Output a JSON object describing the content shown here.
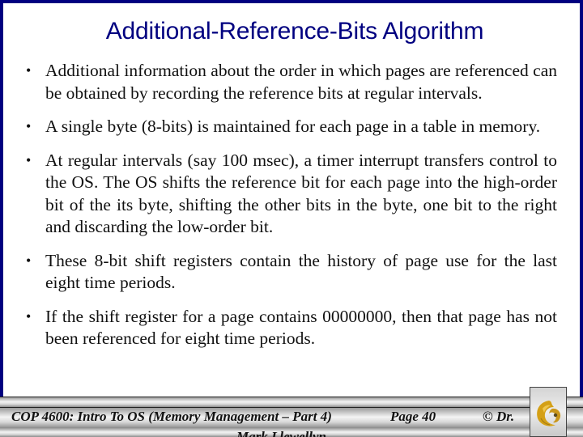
{
  "slide": {
    "title": "Additional-Reference-Bits Algorithm",
    "bullet_glyph": "•",
    "bullets": [
      "Additional information about the order in which pages are referenced can be obtained by recording the reference bits at regular intervals.",
      "A single byte (8-bits) is maintained for each page in a table in memory.",
      "At regular intervals (say 100 msec), a timer interrupt transfers control to the OS.  The OS shifts the reference bit for each page into the high-order bit of the its byte, shifting the other bits in the byte, one bit to the right and discarding the low-order bit.",
      "These 8-bit shift registers contain the history of page use for the last eight time periods.",
      "If the shift register for a page contains 00000000, then that page has not been referenced for eight time periods."
    ]
  },
  "footer": {
    "course": "COP 4600: Intro To OS  (Memory Management – Part 4)",
    "page": "Page 40",
    "copyright": "© Dr.",
    "author": "Mark Llewellyn",
    "logo": "pegasus-logo-icon"
  },
  "colors": {
    "frame": "#000080",
    "title": "#000080",
    "logo_gold": "#d4a017"
  }
}
